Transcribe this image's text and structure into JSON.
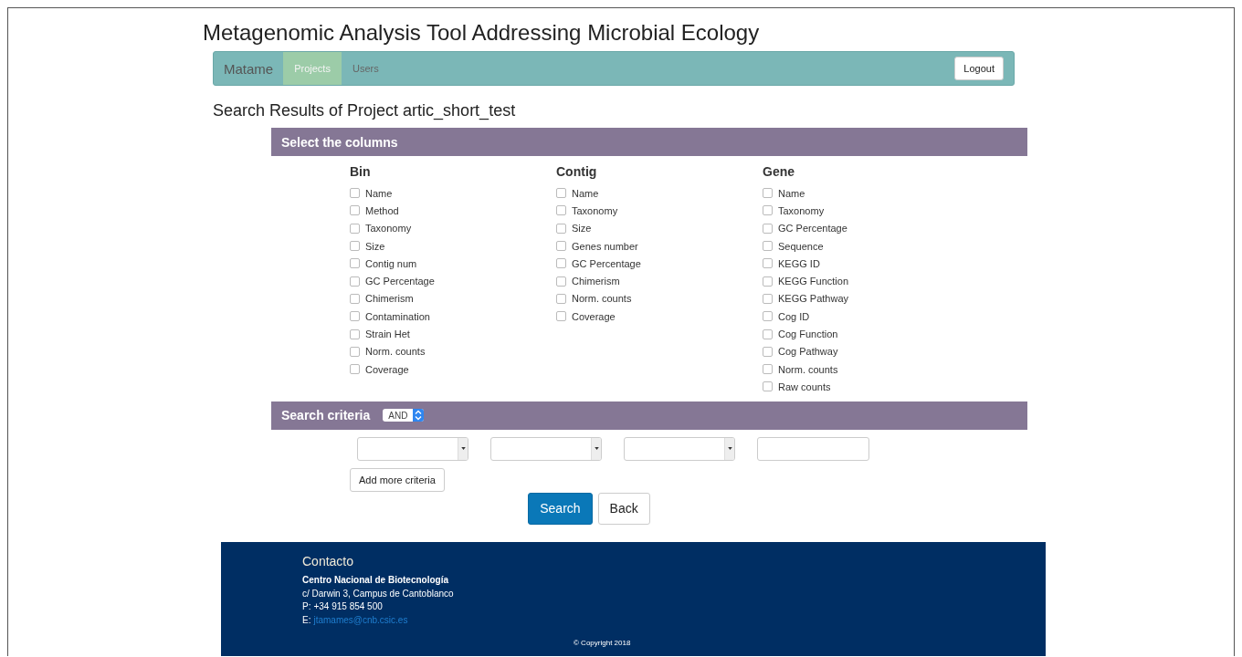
{
  "site_title": "Metagenomic Analysis Tool Addressing Microbial Ecology",
  "navbar": {
    "brand": "Matame",
    "items": [
      {
        "label": "Projects",
        "selected": true
      },
      {
        "label": "Users",
        "selected": false
      }
    ],
    "logout": "Logout"
  },
  "heading": "Search Results of Project artic_short_test",
  "columns_panel": {
    "title": "Select the columns",
    "groups": [
      {
        "title": "Bin",
        "options": [
          {
            "label": "Name",
            "checked": false
          },
          {
            "label": "Method",
            "checked": false
          },
          {
            "label": "Taxonomy",
            "checked": false
          },
          {
            "label": "Size",
            "checked": false
          },
          {
            "label": "Contig num",
            "checked": false
          },
          {
            "label": "GC Percentage",
            "checked": false
          },
          {
            "label": "Chimerism",
            "checked": false
          },
          {
            "label": "Contamination",
            "checked": false
          },
          {
            "label": "Strain Het",
            "checked": false
          },
          {
            "label": "Norm. counts",
            "checked": false
          },
          {
            "label": "Coverage",
            "checked": false
          }
        ]
      },
      {
        "title": "Contig",
        "options": [
          {
            "label": "Name",
            "checked": false
          },
          {
            "label": "Taxonomy",
            "checked": false
          },
          {
            "label": "Size",
            "checked": false
          },
          {
            "label": "Genes number",
            "checked": false
          },
          {
            "label": "GC Percentage",
            "checked": false
          },
          {
            "label": "Chimerism",
            "checked": false
          },
          {
            "label": "Norm. counts",
            "checked": false
          },
          {
            "label": "Coverage",
            "checked": false
          }
        ]
      },
      {
        "title": "Gene",
        "options": [
          {
            "label": "Name",
            "checked": false
          },
          {
            "label": "Taxonomy",
            "checked": false
          },
          {
            "label": "GC Percentage",
            "checked": false
          },
          {
            "label": "Sequence",
            "checked": false
          },
          {
            "label": "KEGG ID",
            "checked": false
          },
          {
            "label": "KEGG Function",
            "checked": false
          },
          {
            "label": "KEGG Pathway",
            "checked": false
          },
          {
            "label": "Cog ID",
            "checked": false
          },
          {
            "label": "Cog Function",
            "checked": false
          },
          {
            "label": "Cog Pathway",
            "checked": false
          },
          {
            "label": "Norm. counts",
            "checked": false
          },
          {
            "label": "Raw counts",
            "checked": false
          }
        ]
      }
    ]
  },
  "criteria_panel": {
    "title": "Search criteria",
    "operator": "AND",
    "fields": [
      {
        "kind": "select"
      },
      {
        "kind": "select"
      },
      {
        "kind": "select"
      },
      {
        "kind": "text"
      }
    ],
    "add_button": "Add more criteria"
  },
  "buttons": [
    {
      "label": "Search",
      "kind": "primary"
    },
    {
      "label": "Back",
      "kind": "default"
    }
  ],
  "footer": {
    "title": "Contacto",
    "org": "Centro Nacional de Biotecnología",
    "address": "c/ Darwin 3, Campus de Cantoblanco",
    "phone_label": "P:",
    "phone": "+34 915 854 500",
    "email_label": "E:",
    "email": "jtamames@cnb.csic.es",
    "copyright": "© Copyright 2018"
  }
}
